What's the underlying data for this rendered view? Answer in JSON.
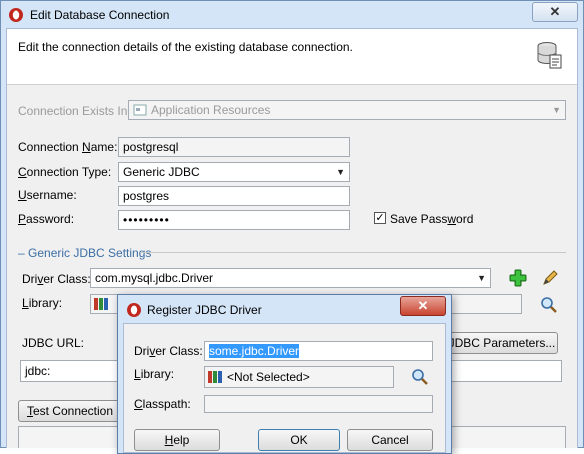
{
  "window": {
    "title": "Edit Database Connection",
    "close_label": "✕",
    "description": "Edit the connection details of the existing database connection."
  },
  "connection_exists_in": {
    "label": "Connection Exists In:",
    "value": "Application Resources"
  },
  "form": {
    "name_label_pre": "Connection ",
    "name_label_key": "N",
    "name_label_post": "ame:",
    "name_value": "postgresql",
    "type_label_pre": "",
    "type_label_key": "C",
    "type_label_post": "onnection Type:",
    "type_value": "Generic JDBC",
    "username_label_pre": "",
    "username_label_key": "U",
    "username_label_post": "sername:",
    "username_value": "postgres",
    "password_label_pre": "",
    "password_label_key": "P",
    "password_label_post": "assword:",
    "password_value": "•••••••••",
    "save_password_pre": "Save Pass",
    "save_password_key": "w",
    "save_password_post": "ord",
    "save_password_checked": true
  },
  "jdbc_settings": {
    "section_title": "– Generic JDBC Settings",
    "driver_label_pre": "Dri",
    "driver_label_key": "v",
    "driver_label_post": "er Class:",
    "driver_value": "com.mysql.jdbc.Driver",
    "library_label_pre": "",
    "library_label_key": "L",
    "library_label_post": "ibrary:",
    "jdbc_url_label": "JDBC URL:",
    "jdbc_params_button": "JDBC Parameters...",
    "jdbc_url_value": "jdbc:",
    "test_button_pre": "",
    "test_button_key": "T",
    "test_button_post": "est Connection"
  },
  "modal": {
    "title": "Register JDBC Driver",
    "close_label": "✕",
    "driver_label_pre": "Dri",
    "driver_label_key": "v",
    "driver_label_post": "er Class:",
    "driver_value": "some.jdbc.Driver",
    "library_label_pre": "",
    "library_label_key": "L",
    "library_label_post": "ibrary:",
    "library_value": "<Not Selected>",
    "classpath_label_pre": "",
    "classpath_label_key": "C",
    "classpath_label_post": "lasspath:",
    "classpath_value": "",
    "help_pre": "",
    "help_key": "H",
    "help_post": "elp",
    "ok_label": "OK",
    "cancel_label": "Cancel"
  },
  "colors": {
    "accent_green": "#2ea82e",
    "selection_blue": "#3399ff"
  }
}
